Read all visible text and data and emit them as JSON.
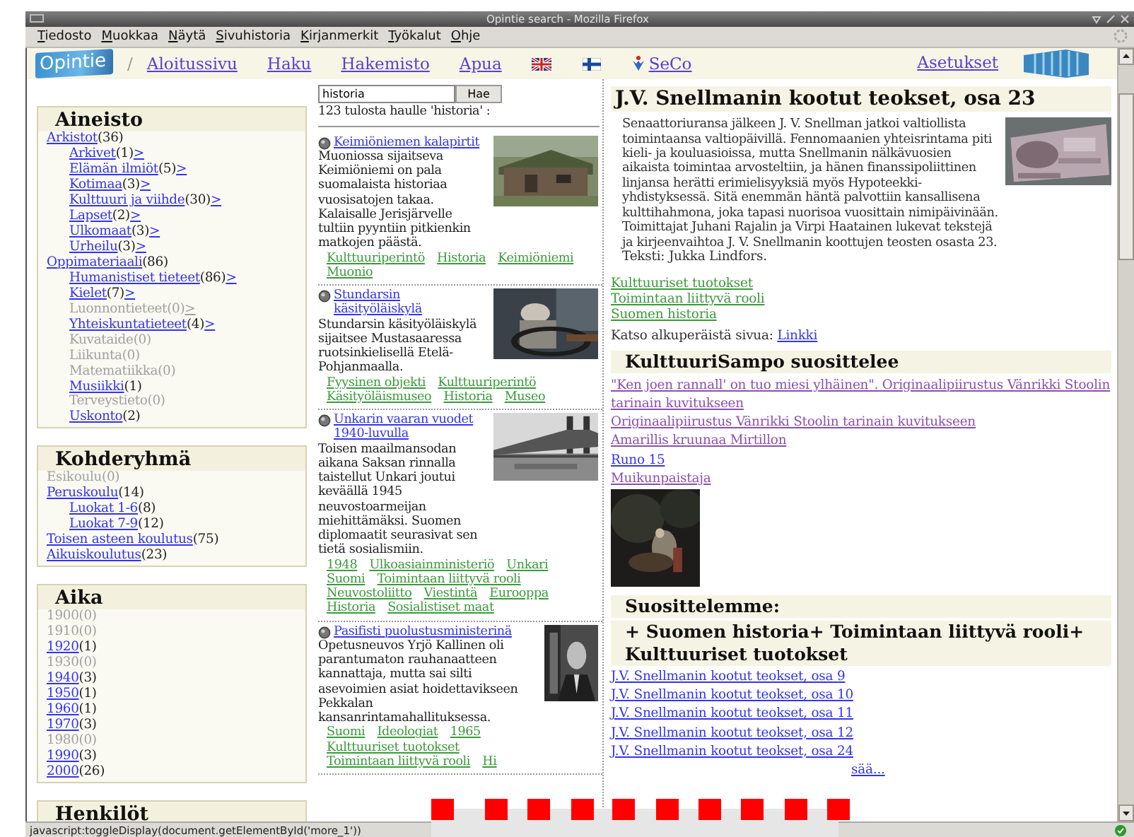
{
  "window": {
    "title": "Opintie search - Mozilla Firefox"
  },
  "menu_bar": [
    "Tiedosto",
    "Muokkaa",
    "Näytä",
    "Sivuhistoria",
    "Kirjanmerkit",
    "Työkalut",
    "Ohje"
  ],
  "nav": {
    "logo": "Opintie",
    "separator": "/",
    "links": [
      "Aloitussivu",
      "Haku",
      "Hakemisto",
      "Apua"
    ],
    "seco": "SeCo",
    "settings": "Asetukset"
  },
  "facets": [
    {
      "title": "Aineisto",
      "items": [
        {
          "label": "Arkistot",
          "count": "(36)",
          "disabled": false,
          "children": [
            {
              "label": "Arkivet",
              "count": "(1)",
              "more": ">",
              "disabled": false
            },
            {
              "label": "Elämän ilmiöt",
              "count": "(5)",
              "more": ">",
              "disabled": false
            },
            {
              "label": "Kotimaa",
              "count": "(3)",
              "more": ">",
              "disabled": false
            },
            {
              "label": "Kulttuuri ja viihde",
              "count": "(30)",
              "more": ">",
              "disabled": false
            },
            {
              "label": "Lapset",
              "count": "(2)",
              "more": ">",
              "disabled": false
            },
            {
              "label": "Ulkomaat",
              "count": "(3)",
              "more": ">",
              "disabled": false
            },
            {
              "label": "Urheilu",
              "count": "(3)",
              "more": ">",
              "disabled": false
            }
          ]
        },
        {
          "label": "Oppimateriaali",
          "count": "(86)",
          "disabled": false,
          "children": [
            {
              "label": "Humanistiset tieteet",
              "count": "(86)",
              "more": ">",
              "disabled": false
            },
            {
              "label": "Kielet",
              "count": "(7)",
              "more": ">",
              "disabled": false
            },
            {
              "label": "Luonnontieteet",
              "count": "(0)",
              "more": ">",
              "disabled": true
            },
            {
              "label": "Yhteiskuntatieteet",
              "count": "(4)",
              "more": ">",
              "disabled": false
            },
            {
              "label": "Kuvataide",
              "count": "(0)",
              "disabled": true
            },
            {
              "label": "Liikunta",
              "count": "(0)",
              "disabled": true
            },
            {
              "label": "Matematiikka",
              "count": "(0)",
              "disabled": true
            },
            {
              "label": "Musiikki",
              "count": "(1)",
              "disabled": false
            },
            {
              "label": "Terveystieto",
              "count": "(0)",
              "disabled": true
            },
            {
              "label": "Uskonto",
              "count": "(2)",
              "disabled": false
            }
          ]
        }
      ]
    },
    {
      "title": "Kohderyhmä",
      "items": [
        {
          "label": "Esikoulu",
          "count": "(0)",
          "disabled": true
        },
        {
          "label": "Peruskoulu",
          "count": "(14)",
          "disabled": false,
          "children": [
            {
              "label": "Luokat 1-6",
              "count": "(8)",
              "disabled": false
            },
            {
              "label": "Luokat 7-9",
              "count": "(12)",
              "disabled": false
            }
          ]
        },
        {
          "label": "Toisen asteen koulutus",
          "count": "(75)",
          "disabled": false
        },
        {
          "label": "Aikuiskoulutus",
          "count": "(23)",
          "disabled": false
        }
      ]
    },
    {
      "title": "Aika",
      "items": [
        {
          "label": "1900",
          "count": "(0)",
          "disabled": true
        },
        {
          "label": "1910",
          "count": "(0)",
          "disabled": true
        },
        {
          "label": "1920",
          "count": "(1)",
          "disabled": false
        },
        {
          "label": "1930",
          "count": "(0)",
          "disabled": true
        },
        {
          "label": "1940",
          "count": "(3)",
          "disabled": false
        },
        {
          "label": "1950",
          "count": "(1)",
          "disabled": false
        },
        {
          "label": "1960",
          "count": "(1)",
          "disabled": false
        },
        {
          "label": "1970",
          "count": "(3)",
          "disabled": false
        },
        {
          "label": "1980",
          "count": "(0)",
          "disabled": true
        },
        {
          "label": "1990",
          "count": "(3)",
          "disabled": false
        },
        {
          "label": "2000",
          "count": "(26)",
          "disabled": false
        }
      ]
    },
    {
      "title": "Henkilöt"
    }
  ],
  "search": {
    "value": "historia",
    "button": "Hae",
    "summary": "123 tulosta haulle 'historia' :"
  },
  "results": [
    {
      "title": "Keimiöniemen kalapirtit",
      "description": "Muoniossa sijaitseva Keimiöniemi on pala suomalaista historiaa vuosisatojen takaa. Kalaisalle Jerisjärvelle tultiin pyyntiin pitkienkin matkojen päästä.",
      "tags": [
        "Kulttuuriperintö",
        "Historia",
        "Keimiöniemi",
        "Muonio"
      ]
    },
    {
      "title": "Stundarsin käsityöläiskylä",
      "description": "Stundarsin käsityöläiskylä sijaitsee Mustasaaressa ruotsinkielisellä Etelä-Pohjanmaalla.",
      "tags": [
        "Fyysinen objekti",
        "Kulttuuriperintö",
        "Käsityöläismuseo",
        "Historia",
        "Museo"
      ]
    },
    {
      "title": "Unkarin vaaran vuodet 1940-luvulla",
      "description": "Toisen maailmansodan aikana Saksan rinnalla taistellut Unkari joutui keväällä 1945 neuvostoarmeijan miehittämäksi. Suomen diplomaatit seurasivat sen tietä sosialismiin.",
      "tags": [
        "1948",
        "Ulkoasiainministeriö",
        "Unkari",
        "Suomi",
        "Toimintaan liittyvä rooli",
        "Neuvostoliitto",
        "Viestintä",
        "Eurooppa",
        "Historia",
        "Sosialistiset maat"
      ]
    },
    {
      "title": "Pasifisti puolustusministerinä",
      "description": "Opetusneuvos Yrjö Kallinen oli parantumaton rauhanaatteen kannattaja, mutta sai silti asevoimien asiat hoidettavikseen Pekkalan kansanrintamahallituksessa.",
      "tags": [
        "Suomi",
        "Ideologiat",
        "1965",
        "Kulttuuriset tuotokset",
        "Toimintaan liittyvä rooli",
        "Hi"
      ]
    }
  ],
  "article": {
    "title": "J.V. Snellmanin kootut teokset, osa 23",
    "text": "Senaattoriuransa jälkeen J. V. Snellman jatkoi valtiollista toimintaansa valtiopäivillä. Fennomaanien yhteisrintama piti kieli- ja kouluasioissa, mutta Snellmanin nälkävuosien aikaista toimintaa arvosteltiin, ja hänen finanssipoliittinen linjansa herätti erimielisyyksiä myös Hypoteekki-yhdistyksessä. Sitä enemmän häntä palvottiin kansallisena kulttihahmona, joka tapasi nuorisoa vuosittain nimipäivinään. Toimittajat Juhani Rajalin ja Virpi Haatainen lukevat tekstejä ja kirjeenvaihtoa J. V. Snellmanin koottujen teosten osasta 23.",
    "credit": "Teksti: Jukka Lindfors.",
    "tags": [
      "Kulttuuriset tuotokset",
      "Toimintaan liittyvä rooli",
      "Suomen historia"
    ],
    "source_label": "Katso alkuperäistä sivua:",
    "source_link": "Linkki"
  },
  "recommend": {
    "title": "KulttuuriSampo suosittelee",
    "links": [
      {
        "label": "\"Ken joen rannall' on tuo miesi ylhäinen\". Originaalipiirustus Vänrikki Stoolin tarinain kuvitukseen",
        "visited": true
      },
      {
        "label": "Originaalipiirustus Vänrikki Stoolin tarinain kuvitukseen",
        "visited": true
      },
      {
        "label": "Amarillis kruunaa Mirtillon",
        "visited": true
      },
      {
        "label": "Runo 15",
        "visited": false
      },
      {
        "label": "Muikunpaistaja",
        "visited": true
      }
    ]
  },
  "suggest": {
    "title": "Suosittelemme:",
    "subtitle": "+ Suomen historia+ Toimintaan liittyvä rooli+ Kulttuuriset tuotokset",
    "links": [
      "J.V. Snellmanin kootut teokset, osa 9",
      "J.V. Snellmanin kootut teokset, osa 10",
      "J.V. Snellmanin kootut teokset, osa 11",
      "J.V. Snellmanin kootut teokset, osa 12",
      "J.V. Snellmanin kootut teokset, osa 24"
    ],
    "more": "sää..."
  },
  "status_bar": "javascript:toggleDisplay(document.getElementById('more_1'))"
}
